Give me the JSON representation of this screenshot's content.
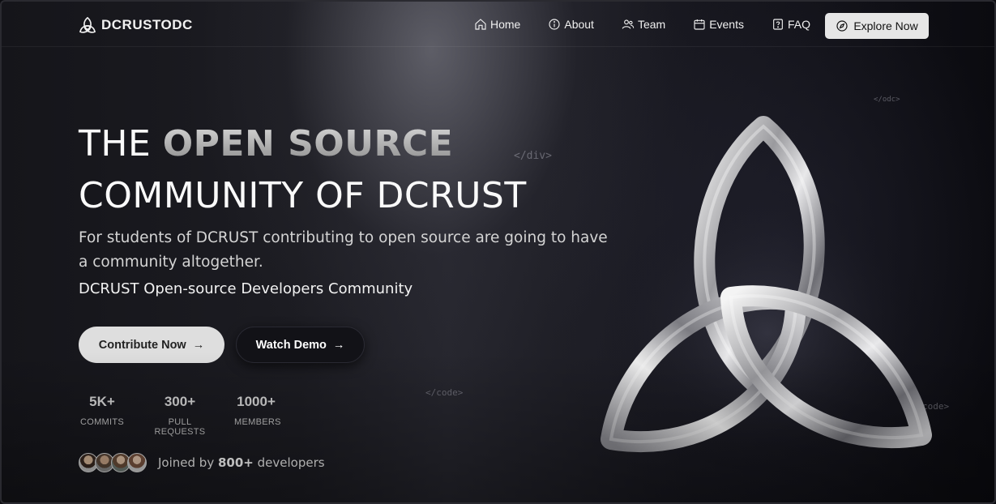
{
  "brand": {
    "name": "DCRUSTODC"
  },
  "nav": {
    "items": [
      {
        "label": "Home",
        "icon": "home-icon"
      },
      {
        "label": "About",
        "icon": "info-icon"
      },
      {
        "label": "Team",
        "icon": "users-icon"
      },
      {
        "label": "Events",
        "icon": "calendar-icon"
      },
      {
        "label": "FAQ",
        "icon": "question-icon"
      }
    ],
    "cta": {
      "label": "Explore Now",
      "icon": "compass-icon"
    }
  },
  "hero": {
    "headline_prefix": "THE",
    "headline_accent": "OPEN SOURCE",
    "headline_line2": "COMMUNITY OF DCRUST",
    "subtext": "For students of DCRUST contributing to open source are going to have a community altogether.",
    "tagline": "DCRUST Open-source Developers Community",
    "primary_button": "Contribute Now",
    "secondary_button": "Watch Demo",
    "arrow": "→"
  },
  "stats": [
    {
      "value": "5K+",
      "label": "COMMITS"
    },
    {
      "value": "300+",
      "label": "PULL REQUESTS"
    },
    {
      "value": "1000+",
      "label": "MEMBERS"
    }
  ],
  "joined": {
    "prefix": "Joined by",
    "count": "800+",
    "suffix": "developers"
  },
  "decor": {
    "code_tags": [
      "</odc>",
      "</div>",
      "</code>",
      "code>"
    ]
  },
  "colors": {
    "background": "#15151a",
    "accent_button": "#dedede",
    "dark_button": "#121217"
  }
}
